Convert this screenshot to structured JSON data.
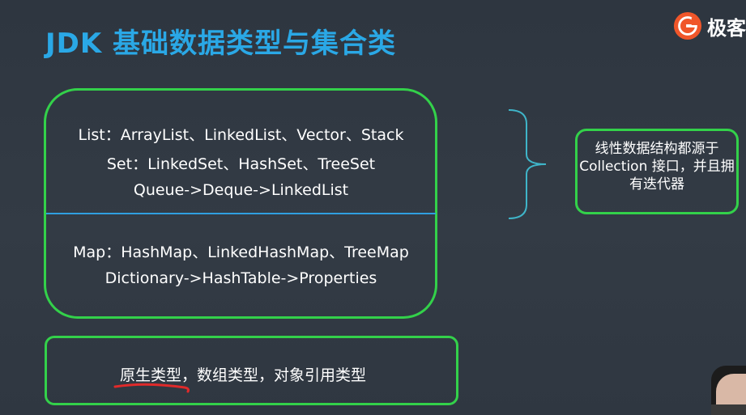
{
  "title": "JDK 基础数据类型与集合类",
  "logo": {
    "text": "极客",
    "icon": "geek-logo-icon",
    "color": "#f0562a"
  },
  "collections_box": {
    "lines": [
      "List：ArrayList、LinkedList、Vector、Stack",
      "Set：LinkedSet、HashSet、TreeSet",
      "Queue->Deque->LinkedList",
      "Map：HashMap、LinkedHashMap、TreeMap",
      "Dictionary->HashTable->Properties"
    ]
  },
  "note": {
    "text": "线性数据结构都源于 Collection 接口，并且拥有迭代器"
  },
  "types_box": {
    "text": "原生类型，数组类型，对象引用类型"
  },
  "colors": {
    "title": "#2aa8e6",
    "box_border": "#33d14a",
    "divider": "#2f9fe0",
    "brace": "#3fb5c9",
    "underline": "#e02a2a",
    "background": "#313943"
  }
}
